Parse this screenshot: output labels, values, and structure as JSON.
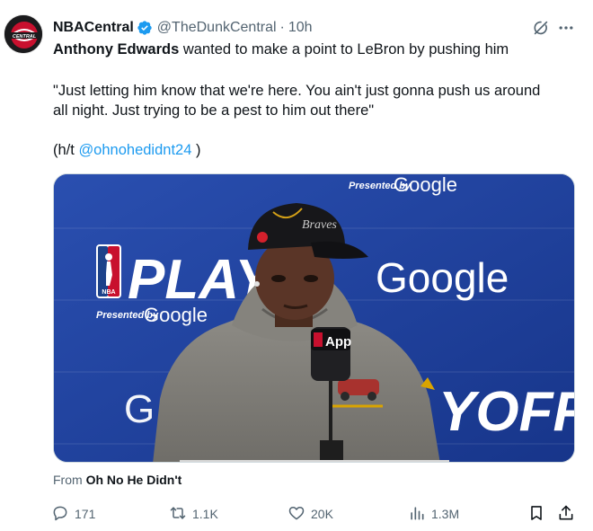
{
  "author": {
    "display_name": "NBACentral",
    "handle": "@TheDunkCentral",
    "separator": "·",
    "time": "10h",
    "avatar_text": "CENTRAL",
    "verified_color": "#1d9bf0"
  },
  "tweet": {
    "mention_name": "Anthony Edwards",
    "line1_rest": " wanted to make a point to LeBron by pushing him",
    "quote_line1": "\"Just letting him know that we're here. You ain't just gonna push us around",
    "quote_line2": "all night. Just trying to be a pest to him out there\"",
    "ht_prefix": "(h/t ",
    "ht_link": "@ohnohedidnt24",
    "ht_suffix": " )"
  },
  "media": {
    "presented_by": "Presented by",
    "google": "Google",
    "playoffs_left": "PLAYO",
    "playoffs_right": "YOFFS",
    "nba_logo_text": "NBA",
    "mic_label": "App",
    "backdrop_color": "#1f3f98"
  },
  "source": {
    "prefix": "From ",
    "name": "Oh No He Didn't"
  },
  "actions": {
    "replies": "171",
    "reposts": "1.1K",
    "likes": "20K",
    "views": "1.3M"
  },
  "icons": {
    "verified": "verified-badge-icon",
    "grok": "grok-icon",
    "more": "more-icon",
    "reply": "reply-icon",
    "repost": "repost-icon",
    "like": "heart-icon",
    "views": "views-icon",
    "bookmark": "bookmark-icon",
    "share": "share-icon"
  }
}
